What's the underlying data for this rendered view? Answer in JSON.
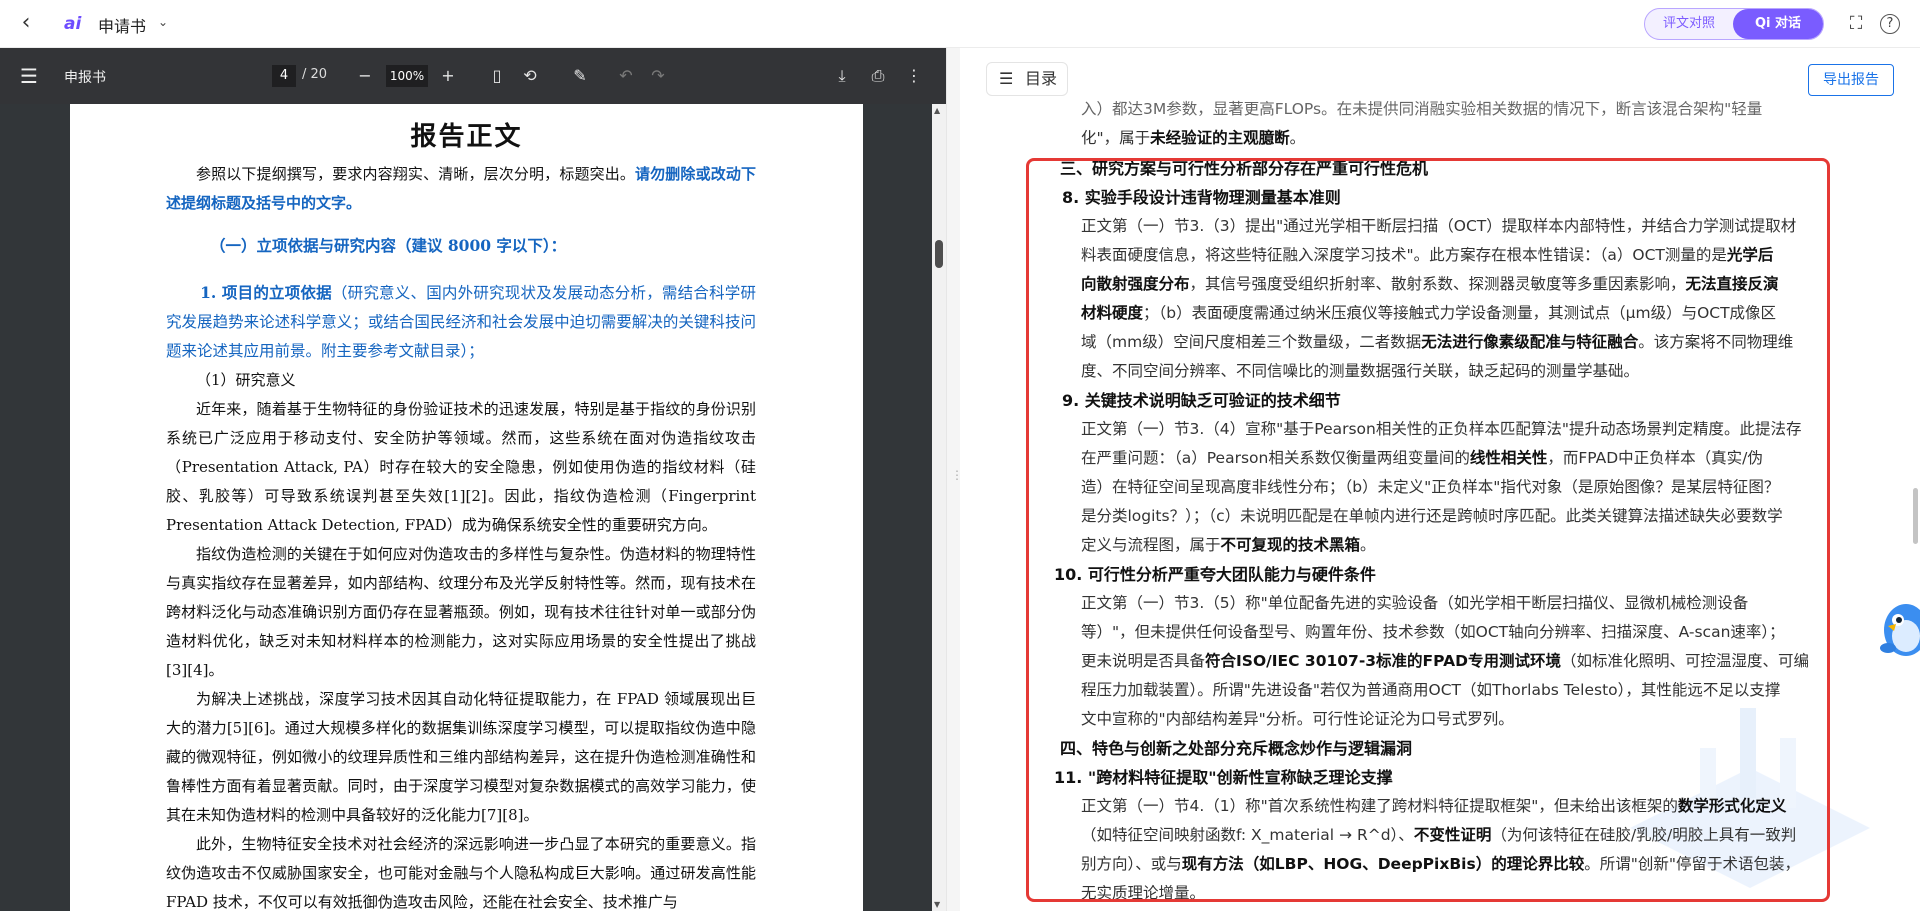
{
  "topbar": {
    "back": "‹",
    "logo": "ai",
    "doc_name": "申请书",
    "caret": "⌄",
    "switch_a": "评文对照",
    "switch_b": "Qi 对话",
    "fullscreen": "⛶",
    "help": "?"
  },
  "pdf": {
    "title": "申报书",
    "page": "4",
    "total": "/ 20",
    "zoom": "100%",
    "page_title": "报告正文",
    "intro_a": "参照以下提纲撰写，要求内容翔实、清晰，层次分明，标题突出。",
    "intro_b": "请勿删除或改动下述提纲标题及括号中的文字。",
    "heading1": "（一）立项依据与研究内容（建议 8000 字以下）：",
    "sub1_a": "1. 项目的立项依据",
    "sub1_b": "（研究意义、国内外研究现状及发展动态分析，需结合科学研究发展趋势来论述科学意义；或结合国民经济和社会发展中迫切需要解决的关键科技问题来论述其应用前景。附主要参考文献目录）；",
    "sub_s1": "（1）研究意义",
    "para1": "近年来，随着基于生物特征的身份验证技术的迅速发展，特别是基于指纹的身份识别系统已广泛应用于移动支付、安全防护等领域。然而，这些系统在面对伪造指纹攻击（Presentation Attack, PA）时存在较大的安全隐患，例如使用伪造的指纹材料（硅胶、乳胶等）可导致系统误判甚至失效[1][2]。因此，指纹伪造检测（Fingerprint Presentation Attack Detection, FPAD）成为确保系统安全性的重要研究方向。",
    "para2": "指纹伪造检测的关键在于如何应对伪造攻击的多样性与复杂性。伪造材料的物理特性与真实指纹存在显著差异，如内部结构、纹理分布及光学反射特性等。然而，现有技术在跨材料泛化与动态准确识别方面仍存在显著瓶颈。例如，现有技术往往针对单一或部分伪造材料优化，缺乏对未知材料样本的检测能力，这对实际应用场景的安全性提出了挑战[3][4]。",
    "para3": "为解决上述挑战，深度学习技术因其自动化特征提取能力，在 FPAD 领域展现出巨大的潜力[5][6]。通过大规模多样化的数据集训练深度学习模型，可以提取指纹伪造中隐藏的微观特征，例如微小的纹理异质性和三维内部结构差异，这在提升伪造检测准确性和鲁棒性方面有着显著贡献。同时，由于深度学习模型对复杂数据模式的高效学习能力，使其在未知伪造材料的检测中具备较好的泛化能力[7][8]。",
    "para4": "此外，生物特征安全技术对社会经济的深远影响进一步凸显了本研究的重要意义。指纹伪造攻击不仅威胁国家安全，也可能对金融与个人隐私构成巨大影响。通过研发高性能 FPAD 技术，不仅可以有效抵御伪造攻击风险，还能在社会安全、技术推广与"
  },
  "report": {
    "toc": "目录",
    "export": "导出报告",
    "prev_tail_1": "入）都达3M参数，显著更高FLOPs。在未提供同消融实验相关数据的情况下，断言该混合架构\"轻量",
    "prev_tail_2a": "化\"，属于",
    "prev_tail_2b": "未经验证的主观臆断",
    "prev_tail_2c": "。",
    "sec3": "三、研究方案与可行性分析部分存在严重可行性危机",
    "i8": "8. 实验手段设计违背物理测量基本准则",
    "b8_1": "正文第（一）节3.（3）提出\"通过光学相干断层扫描（OCT）提取样本内部特性，并结合力学测试提取材",
    "b8_2a": "料表面硬度信息，将这些特征融入深度学习技术\"。此方案存在根本性错误：（a）OCT测量的是",
    "b8_2b": "光学后",
    "b8_3a": "向散射强度分布",
    "b8_3b": "，其信号强度受组织折射率、散射系数、探测器灵敏度等多重因素影响，",
    "b8_3c": "无法直接反演",
    "b8_4a": "材料硬度",
    "b8_4b": "；（b）表面硬度需通过纳米压痕仪等接触式力学设备测量，其测试点（μm级）与OCT成像区",
    "b8_5a": "域（mm级）空间尺度相差三个数量级，二者数据",
    "b8_5b": "无法进行像素级配准与特征融合",
    "b8_5c": "。该方案将不同物理维",
    "b8_6": "度、不同空间分辨率、不同信噪比的测量数据强行关联，缺乏起码的测量学基础。",
    "i9": "9. 关键技术说明缺乏可验证的技术细节",
    "b9_1": "正文第（一）节3.（4）宣称\"基于Pearson相关性的正负样本匹配算法\"提升动态场景判定精度。此提法存",
    "b9_2a": "在严重问题：（a）Pearson相关系数仅衡量两组变量间的",
    "b9_2b": "线性相关性",
    "b9_2c": "，而FPAD中正负样本（真实/伪",
    "b9_3": "造）在特征空间呈现高度非线性分布；（b）未定义\"正负样本\"指代对象（是原始图像？是某层特征图？",
    "b9_4": "是分类logits？）；（c）未说明匹配是在单帧内进行还是跨帧时序匹配。此类关键算法描述缺失必要数学",
    "b9_5a": "定义与流程图，属于",
    "b9_5b": "不可复现的技术黑箱",
    "b9_5c": "。",
    "i10": "10. 可行性分析严重夸大团队能力与硬件条件",
    "b10_1": "正文第（一）节3.（5）称\"单位配备先进的实验设备（如光学相干断层扫描仪、显微机械检测设备",
    "b10_2": "等）\"，但未提供任何设备型号、购置年份、技术参数（如OCT轴向分辨率、扫描深度、A-scan速率）；",
    "b10_3a": "更未说明是否具备",
    "b10_3b": "符合ISO/IEC 30107-3标准的FPAD专用测试环境",
    "b10_3c": "（如标准化照明、可控温湿度、可编",
    "b10_4": "程压力加载装置）。所谓\"先进设备\"若仅为普通商用OCT（如Thorlabs Telesto），其性能远不足以支撑",
    "b10_5": "文中宣称的\"内部结构差异\"分析。可行性论证沦为口号式罗列。",
    "sec4": "四、特色与创新之处部分充斥概念炒作与逻辑漏洞",
    "i11": "11. \"跨材料特征提取\"创新性宣称缺乏理论支撑",
    "b11_1a": "正文第（一）节4.（1）称\"首次系统性构建了跨材料特征提取框架\"，但未给出该框架的",
    "b11_1b": "数学形式化定义",
    "b11_2a": "（如特征空间映射函数f: X_material → R^d）、",
    "b11_2b": "不变性证明",
    "b11_2c": "（为何该特征在硅胶/乳胶/明胶上具有一致判",
    "b11_3a": "别方向）、或与",
    "b11_3b": "现有方法（如LBP、HOG、DeepPixBis）的理论界比较",
    "b11_3c": "。所谓\"创新\"停留于术语包装，",
    "b11_4": "无实质理论增量。"
  }
}
